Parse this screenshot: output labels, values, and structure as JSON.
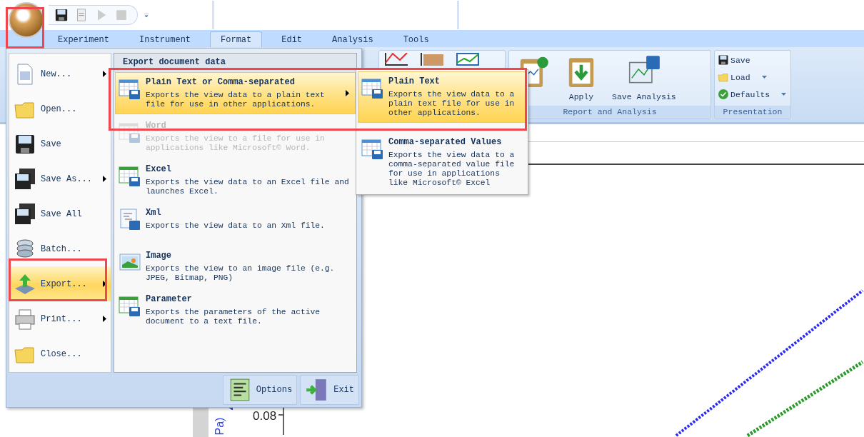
{
  "ribbon_tabs": [
    {
      "label": "Experiment",
      "selected": false
    },
    {
      "label": "Instrument",
      "selected": false
    },
    {
      "label": "Format",
      "selected": true
    },
    {
      "label": "Edit",
      "selected": false
    },
    {
      "label": "Analysis",
      "selected": false
    },
    {
      "label": "Tools",
      "selected": false
    }
  ],
  "ribbon": {
    "report_group": {
      "label": "Report and Analysis",
      "buttons": [
        "Apply",
        "Save Analysis"
      ]
    },
    "presentation_group": {
      "label": "Presentation",
      "items": [
        {
          "label": "Save",
          "has_dropdown": false
        },
        {
          "label": "Load",
          "has_dropdown": true
        },
        {
          "label": "Defaults",
          "has_dropdown": true
        }
      ]
    }
  },
  "app_menu": {
    "items": [
      {
        "label": "New...",
        "has_submenu": true,
        "selected": false
      },
      {
        "label": "Open...",
        "has_submenu": false,
        "selected": false
      },
      {
        "label": "Save",
        "has_submenu": false,
        "selected": false
      },
      {
        "label": "Save As...",
        "has_submenu": true,
        "selected": false
      },
      {
        "label": "Save All",
        "has_submenu": false,
        "selected": false
      },
      {
        "label": "Batch...",
        "has_submenu": false,
        "selected": false
      },
      {
        "label": "Export...",
        "has_submenu": true,
        "selected": true
      },
      {
        "label": "Print...",
        "has_submenu": true,
        "selected": false
      },
      {
        "label": "Close...",
        "has_submenu": false,
        "selected": false
      }
    ],
    "panel_title": "Export document data",
    "export_options": [
      {
        "title": "Plain Text or Comma-separated",
        "description": "Exports the view data to a plain text file for use in other applications.",
        "selected": true,
        "disabled": false,
        "has_submenu": true
      },
      {
        "title": "Word",
        "description": "Exports the view to a file for use in applications like Microsoft© Word.",
        "selected": false,
        "disabled": true,
        "has_submenu": false
      },
      {
        "title": "Excel",
        "description": "Exports the view data to an Excel file and launches Excel.",
        "selected": false,
        "disabled": false,
        "has_submenu": false
      },
      {
        "title": "Xml",
        "description": "Exports the view data to an Xml file.",
        "selected": false,
        "disabled": false,
        "has_submenu": false
      },
      {
        "title": "Image",
        "description": "Exports the view to an image file (e.g. JPEG, Bitmap, PNG)",
        "selected": false,
        "disabled": false,
        "has_submenu": false
      },
      {
        "title": "Parameter",
        "description": "Exports the parameters of the active document to a text file.",
        "selected": false,
        "disabled": false,
        "has_submenu": false
      }
    ],
    "footer_buttons": [
      "Options",
      "Exit"
    ]
  },
  "submenu": [
    {
      "title": "Plain Text",
      "description": "Exports the view data to a plain text file for use in other applications.",
      "selected": true
    },
    {
      "title": "Comma-separated Values",
      "description": "Exports the view data to a comma-separated value file for use in applications like Microsoft© Excel",
      "selected": false
    }
  ],
  "chart": {
    "tick_label": "0.08",
    "axis_label": "Pa)"
  }
}
